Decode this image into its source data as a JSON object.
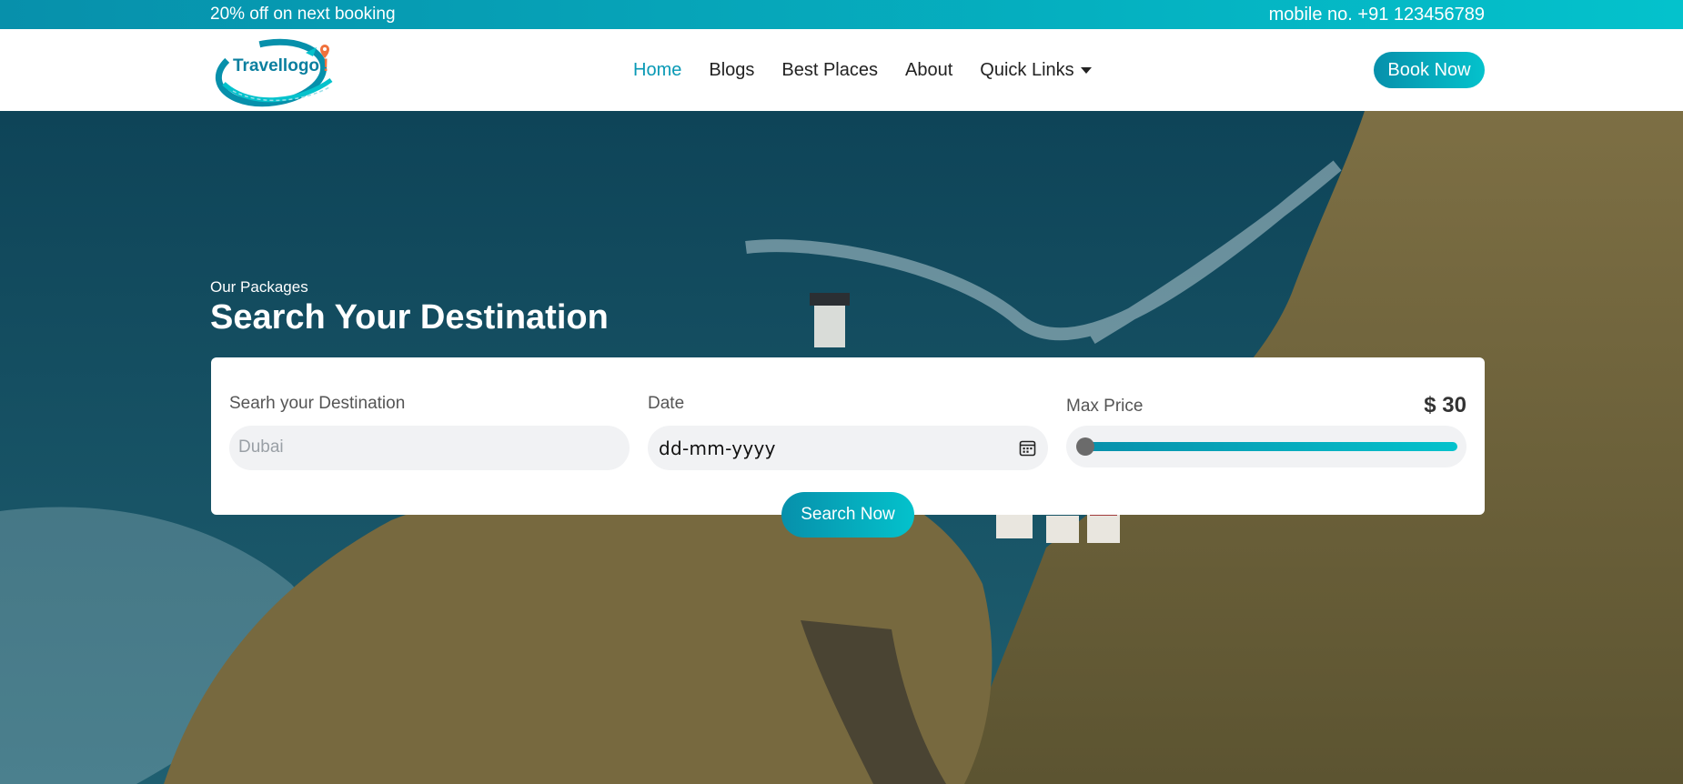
{
  "topbar": {
    "offer": "20% off on next booking",
    "contact": "mobile no. +91 123456789"
  },
  "brand": {
    "logo_text": "Travellogo",
    "logo_accent": "!"
  },
  "nav": {
    "home": "Home",
    "blogs": "Blogs",
    "best_places": "Best Places",
    "about": "About",
    "quick_links": "Quick Links",
    "book_now": "Book Now"
  },
  "hero": {
    "eyebrow": "Our Packages",
    "title": "Search Your Destination"
  },
  "search": {
    "destination_label": "Searh your Destination",
    "destination_placeholder": "Dubai",
    "date_label": "Date",
    "date_placeholder": "dd-mm-yyyy",
    "price_label": "Max Price",
    "price_value": "$ 30",
    "price_slider_fraction": 0,
    "submit": "Search Now"
  },
  "icons": {
    "calendar": "calendar-icon",
    "caret": "chevron-down-icon",
    "location": "location-pin-icon"
  },
  "colors": {
    "accent": "#0899b5",
    "gradient_start": "#0790ab",
    "gradient_end": "#04c2cc",
    "logo_orange": "#f0713c"
  }
}
